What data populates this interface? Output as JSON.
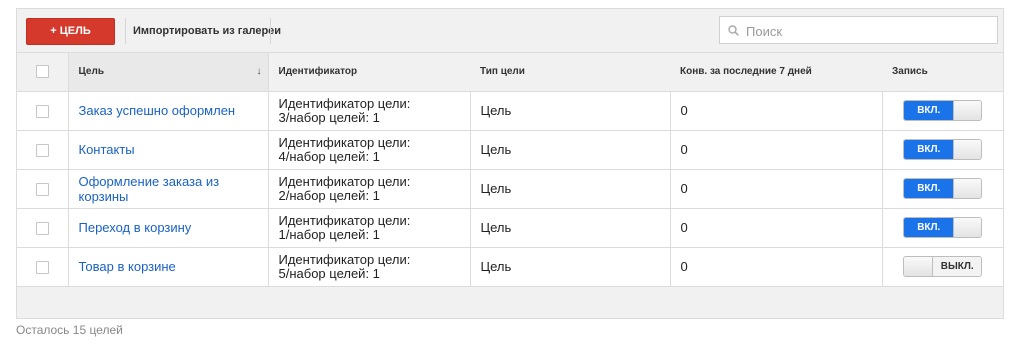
{
  "toolbar": {
    "add_goal_label": "+ ЦЕЛЬ",
    "import_label": "Импортировать из галереи"
  },
  "search": {
    "placeholder": "Поиск",
    "value": ""
  },
  "table": {
    "columns": [
      "",
      "Цель",
      "Идентификатор",
      "Тип цели",
      "Конв. за последние 7 дней",
      "Запись"
    ],
    "sort_column": "Цель",
    "sort_direction": "descending",
    "rows": [
      {
        "goal": "Заказ успешно оформлен",
        "id_line1": "Идентификатор цели:",
        "id_line2": "3/набор целей: 1",
        "type": "Цель",
        "conversions": "0",
        "record_label": "ВКЛ.",
        "record_on": true
      },
      {
        "goal": "Контакты",
        "id_line1": "Идентификатор цели:",
        "id_line2": "4/набор целей: 1",
        "type": "Цель",
        "conversions": "0",
        "record_label": "ВКЛ.",
        "record_on": true
      },
      {
        "goal": "Оформление заказа из корзины",
        "id_line1": "Идентификатор цели:",
        "id_line2": "2/набор целей: 1",
        "type": "Цель",
        "conversions": "0",
        "record_label": "ВКЛ.",
        "record_on": true
      },
      {
        "goal": "Переход в корзину",
        "id_line1": "Идентификатор цели:",
        "id_line2": "1/набор целей: 1",
        "type": "Цель",
        "conversions": "0",
        "record_label": "ВКЛ.",
        "record_on": true
      },
      {
        "goal": "Товар в корзине",
        "id_line1": "Идентификатор цели:",
        "id_line2": "5/набор целей: 1",
        "type": "Цель",
        "conversions": "0",
        "record_label": "ВЫКЛ.",
        "record_on": false
      }
    ]
  },
  "footer": {
    "remaining": "Осталось 15 целей"
  },
  "colors": {
    "add_button": "#d5392b",
    "toggle_on": "#1a73e8",
    "link": "#1a62c4"
  },
  "icons": {
    "search": "search-icon",
    "sort": "sort-arrow-down-icon"
  }
}
